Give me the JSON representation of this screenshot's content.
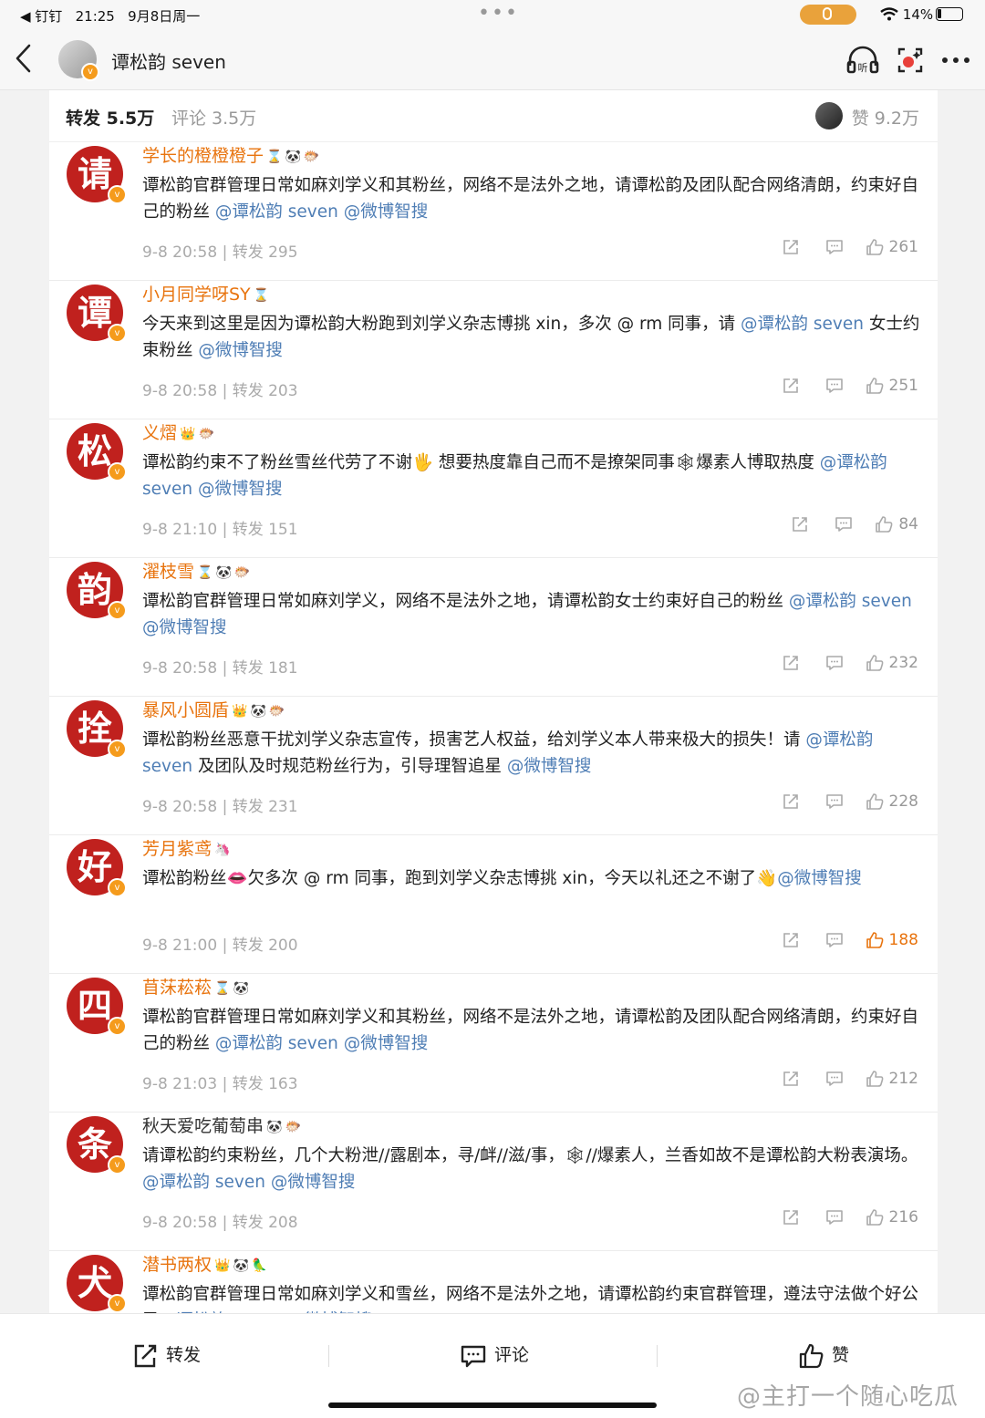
{
  "status_bar": {
    "app": "◀ 钉钉",
    "time": "21:25",
    "date": "9月8日周一",
    "battery": "14%"
  },
  "header": {
    "title": "谭松韵 seven",
    "icons": [
      "back-icon",
      "listen-icon",
      "ai-search-icon",
      "more-icon"
    ]
  },
  "tabs": {
    "repost_label": "转发 5.5万",
    "comment_label": "评论 3.5万",
    "like_label": "赞 9.2万"
  },
  "reposts": [
    {
      "avatar_char": "请",
      "name": "学长的橙橙橙子",
      "badges": [
        "⌛",
        "🐼",
        "🐡"
      ],
      "text_segments": [
        {
          "t": "谭松韵官群管理日常如麻刘学义和其粉丝，网络不是法外之地，请谭松韵及团队配合网络清朗，约束好自己的粉丝 ",
          "at": false
        },
        {
          "t": "@谭松韵 seven",
          "at": true
        },
        {
          "t": " ",
          "at": false
        },
        {
          "t": "@微博智搜",
          "at": true
        }
      ],
      "meta": "9-8 20:58 | 转发 295",
      "likes": "261",
      "name_color": "orange"
    },
    {
      "avatar_char": "谭",
      "name": "小月同学呀SY",
      "badges": [
        "⌛"
      ],
      "text_segments": [
        {
          "t": "今天来到这里是因为谭松韵大粉跑到刘学义杂志博挑 xin，多次 @ rm 同事，请 ",
          "at": false
        },
        {
          "t": "@谭松韵 seven",
          "at": true
        },
        {
          "t": " 女士约束粉丝 ",
          "at": false
        },
        {
          "t": "@微博智搜",
          "at": true
        }
      ],
      "meta": "9-8 20:58 | 转发 203",
      "likes": "251",
      "name_color": "orange"
    },
    {
      "avatar_char": "松",
      "name": "义熠",
      "badges": [
        "👑",
        "🐡"
      ],
      "text_segments": [
        {
          "t": "谭松韵约束不了粉丝雪丝代劳了不谢🖐 想要热度靠自己而不是撩架同事🕸爆素人博取热度 ",
          "at": false
        },
        {
          "t": "@谭松韵 seven",
          "at": true
        },
        {
          "t": " ",
          "at": false
        },
        {
          "t": "@微博智搜",
          "at": true
        }
      ],
      "meta": "9-8 21:10 | 转发 151",
      "likes": "84",
      "name_color": "orange"
    },
    {
      "avatar_char": "韵",
      "name": "濯枝雪",
      "badges": [
        "⌛",
        "🐼",
        "🐡"
      ],
      "text_segments": [
        {
          "t": "谭松韵官群管理日常如麻刘学义，网络不是法外之地，请谭松韵女士约束好自己的粉丝 ",
          "at": false
        },
        {
          "t": "@谭松韵 seven",
          "at": true
        },
        {
          "t": " ",
          "at": false
        },
        {
          "t": "@微博智搜",
          "at": true
        }
      ],
      "meta": "9-8 20:58 | 转发 181",
      "likes": "232",
      "name_color": "orange"
    },
    {
      "avatar_char": "拴",
      "name": "暴风小圆盾",
      "badges": [
        "👑",
        "🐼",
        "🐡"
      ],
      "text_segments": [
        {
          "t": "谭松韵粉丝恶意干扰刘学义杂志宣传，损害艺人权益，给刘学义本人带来极大的损失！请 ",
          "at": false
        },
        {
          "t": "@谭松韵 seven",
          "at": true
        },
        {
          "t": " 及团队及时规范粉丝行为，引导理智追星 ",
          "at": false
        },
        {
          "t": "@微博智搜",
          "at": true
        }
      ],
      "meta": "9-8 20:58 | 转发 231",
      "likes": "228",
      "name_color": "orange"
    },
    {
      "avatar_char": "好",
      "name": "芳月紫鸢",
      "badges": [
        "🦄"
      ],
      "text_segments": [
        {
          "t": "谭松韵粉丝👄欠多次 @ rm 同事，跑到刘学义杂志博挑 xin，今天以礼还之不谢了👋",
          "at": false
        },
        {
          "t": "@微博智搜",
          "at": true
        }
      ],
      "meta": "9-8 21:00 | 转发 200",
      "likes": "188",
      "likes_active": true,
      "name_color": "orange"
    },
    {
      "avatar_char": "四",
      "name": "苜莯菘菘",
      "badges": [
        "⌛",
        "🐼"
      ],
      "text_segments": [
        {
          "t": "谭松韵官群管理日常如麻刘学义和其粉丝，网络不是法外之地，请谭松韵及团队配合网络清朗，约束好自己的粉丝 ",
          "at": false
        },
        {
          "t": "@谭松韵 seven",
          "at": true
        },
        {
          "t": " ",
          "at": false
        },
        {
          "t": "@微博智搜",
          "at": true
        }
      ],
      "meta": "9-8 21:03 | 转发 163",
      "likes": "212",
      "name_color": "orange"
    },
    {
      "avatar_char": "条",
      "name": "秋天爱吃葡萄串",
      "badges": [
        "🐼",
        "🐡"
      ],
      "text_segments": [
        {
          "t": "请谭松韵约束粉丝，几个大粉泄//露剧本，寻/衅//滋/事，🕸//爆素人，兰香如故不是谭松韵大粉表演场。",
          "at": false
        },
        {
          "t": "@谭松韵 seven",
          "at": true
        },
        {
          "t": " ",
          "at": false
        },
        {
          "t": "@微博智搜",
          "at": true
        }
      ],
      "meta": "9-8 20:58 | 转发 208",
      "likes": "216",
      "name_color": "plain"
    },
    {
      "avatar_char": "犬",
      "name": "潜书两权",
      "badges": [
        "👑",
        "🐼",
        "🦜"
      ],
      "text_segments": [
        {
          "t": "谭松韵官群管理日常如麻刘学义和雪丝，网络不是法外之地，请谭松韵约束官群管理，遵法守法做个好公民",
          "at": false
        },
        {
          "t": "@谭松韵 seven",
          "at": true
        },
        {
          "t": " ",
          "at": false
        },
        {
          "t": "@微博智搜",
          "at": true
        }
      ],
      "meta": "",
      "likes": "",
      "name_color": "orange"
    }
  ],
  "bottom_bar": {
    "repost_label": "转发",
    "comment_label": "评论",
    "like_label": "赞"
  },
  "watermark": "@主打一个随心吃瓜",
  "colors": {
    "accent_orange": "#e8740f",
    "mention_blue": "#4f7eb5",
    "avatar_red": "#c0211e",
    "verified_orange": "#f59b1c"
  }
}
